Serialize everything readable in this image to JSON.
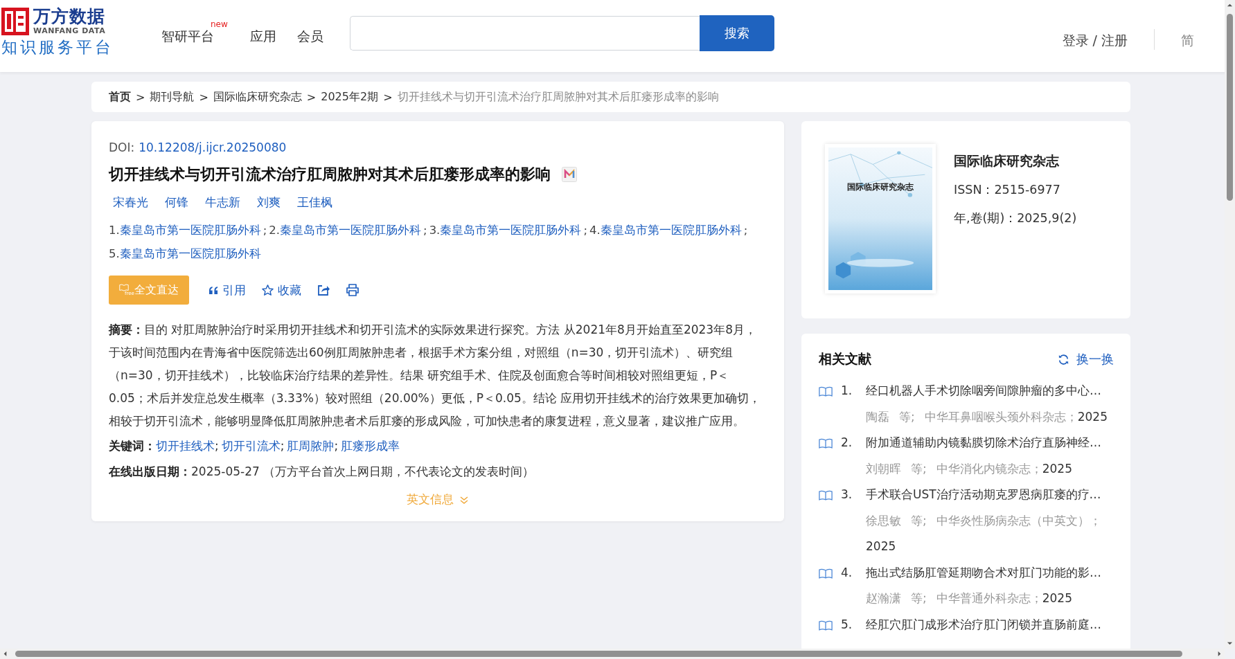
{
  "header": {
    "logo": {
      "name": "万方数据",
      "latin": "WANFANG DATA",
      "tagline": "知识服务平台"
    },
    "nav": [
      {
        "label": "智研平台",
        "badge": "new"
      },
      {
        "label": "应用"
      },
      {
        "label": "会员"
      }
    ],
    "search": {
      "button": "搜索"
    },
    "login": "登录 / 注册",
    "language": "简"
  },
  "breadcrumb": {
    "separator": ">",
    "items": [
      {
        "label": "首页",
        "kind": "home"
      },
      {
        "label": "期刊导航",
        "kind": "link"
      },
      {
        "label": "国际临床研究杂志",
        "kind": "link"
      },
      {
        "label": "2025年2期",
        "kind": "link"
      },
      {
        "label": "切开挂线术与切开引流术治疗肛周脓肿对其术后肛瘘形成率的影响",
        "kind": "current"
      }
    ]
  },
  "article": {
    "doi_label": "DOI:",
    "doi": "10.12208/j.ijcr.20250080",
    "title": "切开挂线术与切开引流术治疗肛周脓肿对其术后肛瘘形成率的影响",
    "authors": [
      "宋春光",
      "何锋",
      "牛志新",
      "刘爽",
      "王佳枫"
    ],
    "affiliation_separator": ";",
    "affiliations": [
      {
        "num": "1.",
        "name": "秦皇岛市第一医院肛肠外科"
      },
      {
        "num": "2.",
        "name": "秦皇岛市第一医院肛肠外科"
      },
      {
        "num": "3.",
        "name": "秦皇岛市第一医院肛肠外科"
      },
      {
        "num": "4.",
        "name": "秦皇岛市第一医院肛肠外科"
      },
      {
        "num": "5.",
        "name": "秦皇岛市第一医院肛肠外科"
      }
    ],
    "actions": [
      {
        "kind": "fulltext",
        "label": "全文直达",
        "icon_text": "free"
      },
      {
        "kind": "cite",
        "label": "引用"
      },
      {
        "kind": "favorite",
        "label": "收藏"
      },
      {
        "kind": "share"
      },
      {
        "kind": "print"
      }
    ],
    "abstract": "**摘要：**目的 对肛周脓肿治疗时采用切开挂线术和切开引流术的实际效果进行探究。方法 从2021年8月开始直至2023年8月，于该时间范围内在青海省中医院筛选出60例肛周脓肿患者，根据手术方案分组，对照组（n=30，切开引流术）、研究组（n=30，切开挂线术），比较临床治疗结果的差异性。结果 研究组手术、住院及创面愈合等时间相较对照组更短，P＜0.05；术后并发症总发生概率（3.33%）较对照组（20.00%）更低，P＜0.05。结论 应用切开挂线术的治疗效果更加确切，相较于切开引流术，能够明显降低肛周脓肿患者术后肛瘘的形成风险，可加快患者的康复进程，意义显著，建议推广应用。",
    "keywords_label": "关键词：",
    "keyword_separator": ";",
    "keywords": [
      "切开挂线术",
      "切开引流术",
      "肛周脓肿",
      "肛瘘形成率"
    ],
    "published": "**在线出版日期：**2025-05-27 （万方平台首次上网日期，不代表论文的发表时间）",
    "english_toggle": "英文信息",
    "expanded": false
  },
  "journal": {
    "cover_title": "国际临床研究杂志",
    "name": "国际临床研究杂志",
    "issn": "ISSN：2515-6977",
    "issue": "年,卷(期)：2025,9(2)"
  },
  "related": {
    "title": "相关文献",
    "refresh": "换一换",
    "items": [
      {
        "num": "1.",
        "title": "经口机器人手术切除咽旁间隙肿瘤的多中心…",
        "author": "陶磊",
        "etal": "等;",
        "journal": "中华耳鼻咽喉头颈外科杂志；",
        "year": "2025"
      },
      {
        "num": "2.",
        "title": "附加通道辅助内镜黏膜切除术治疗直肠神经…",
        "author": "刘朝晖",
        "etal": "等;",
        "journal": "中华消化内镜杂志；",
        "year": "2025"
      },
      {
        "num": "3.",
        "title": "手术联合UST治疗活动期克罗恩病肛瘘的疗…",
        "author": "徐思敏",
        "etal": "等;",
        "journal": "中华炎性肠病杂志（中英文）；",
        "year": "2025"
      },
      {
        "num": "4.",
        "title": "拖出式结肠肛管延期吻合术对肛门功能的影…",
        "author": "赵瀚潇",
        "etal": "等;",
        "journal": "中华普通外科杂志；",
        "year": "2025"
      },
      {
        "num": "5.",
        "title": "经肛穴肛门成形术治疗肛门闭锁并直肠前庭…"
      }
    ]
  }
}
